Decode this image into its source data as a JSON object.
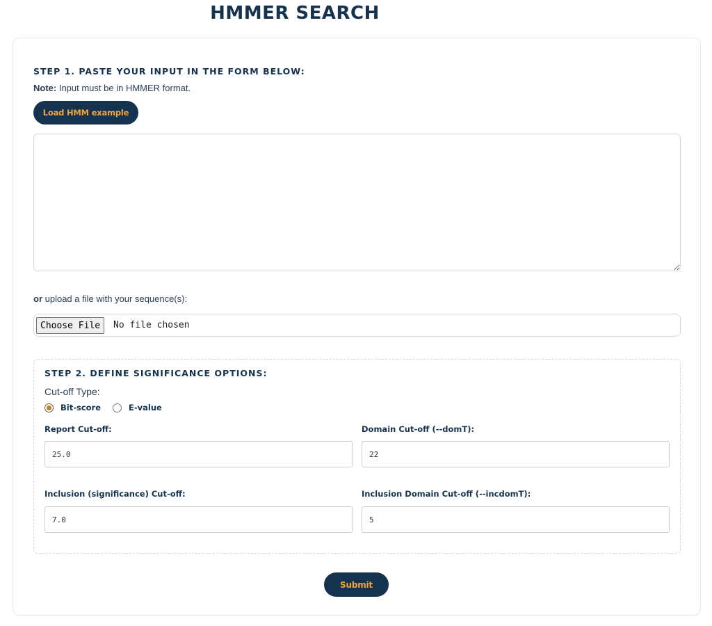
{
  "page": {
    "title": "HMMER SEARCH"
  },
  "step1": {
    "heading": "STEP 1. PASTE YOUR INPUT IN THE FORM BELOW:",
    "note_label": "Note:",
    "note_text": " Input must be in HMMER format.",
    "load_example_label": "Load HMM example",
    "textarea_value": "",
    "upload_or": "or",
    "upload_text": " upload a file with your sequence(s):",
    "choose_file_label": "Choose File",
    "no_file_text": "No file chosen"
  },
  "step2": {
    "heading": "STEP 2. DEFINE SIGNIFICANCE OPTIONS:",
    "cutoff_type_label": "Cut-off Type:",
    "radio_options": [
      {
        "label": "Bit-score",
        "checked": true
      },
      {
        "label": "E-value",
        "checked": false
      }
    ],
    "report_cutoff": {
      "label": "Report Cut-off:",
      "value": "25.0"
    },
    "domain_cutoff": {
      "label": "Domain Cut-off (--domT):",
      "value": "22"
    },
    "inclusion_cutoff": {
      "label": "Inclusion (significance) Cut-off:",
      "value": "7.0"
    },
    "inclusion_domain_cutoff": {
      "label": "Inclusion Domain Cut-off (--incdomT):",
      "value": "5"
    }
  },
  "submit_label": "Submit",
  "colors": {
    "navy": "#15324f",
    "accent_orange": "#f0a43c",
    "radio_checked": "#b0853a"
  }
}
